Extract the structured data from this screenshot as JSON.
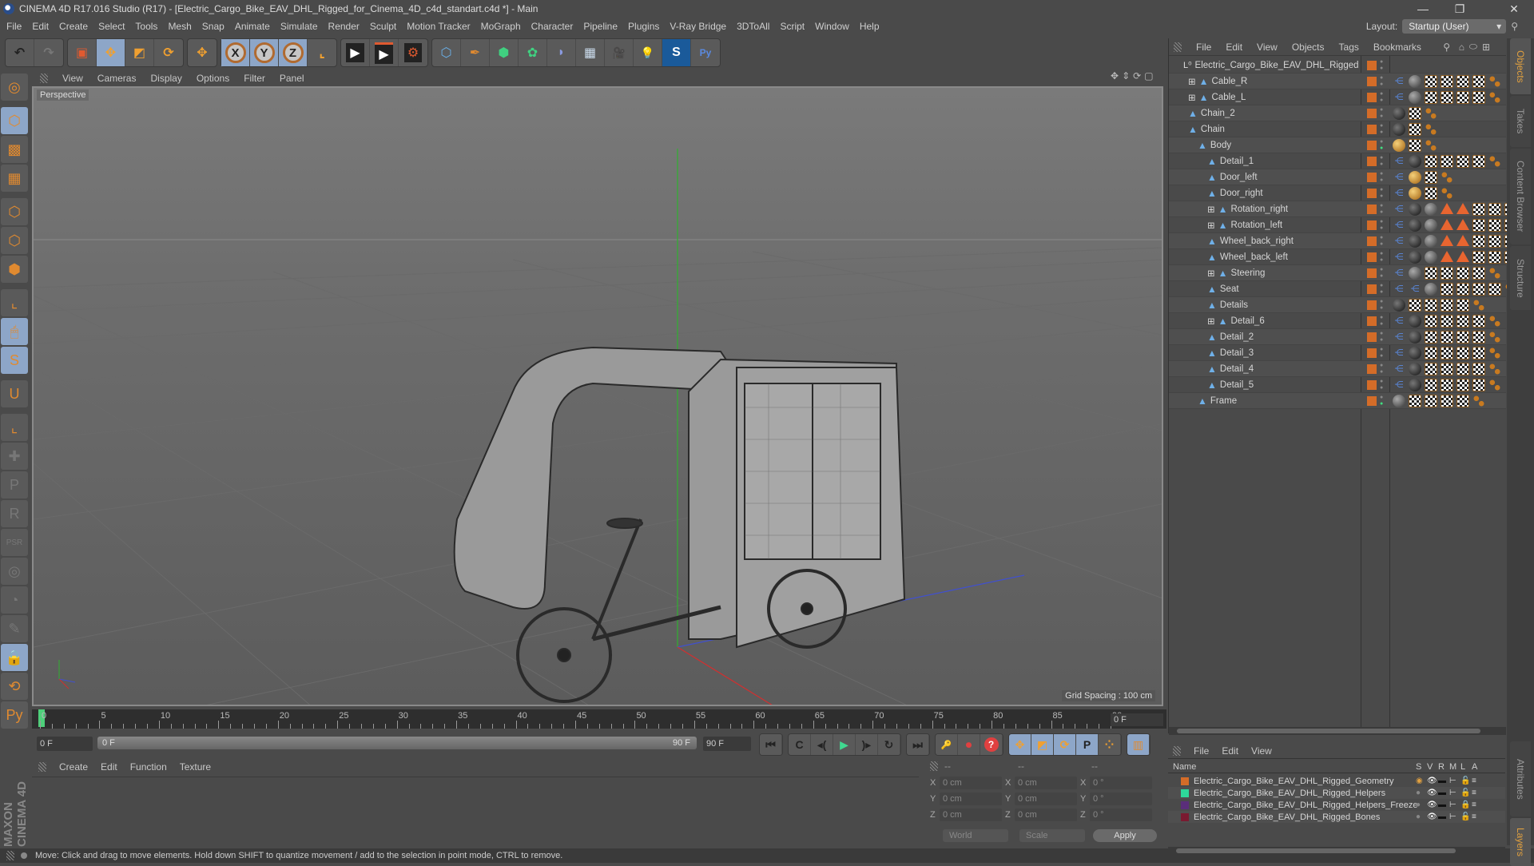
{
  "window": {
    "title": "CINEMA 4D R17.016 Studio (R17) - [Electric_Cargo_Bike_EAV_DHL_Rigged_for_Cinema_4D_c4d_standart.c4d *] - Main",
    "minimize": "—",
    "maximize": "❐",
    "close": "✕"
  },
  "menubar": [
    "File",
    "Edit",
    "Create",
    "Select",
    "Tools",
    "Mesh",
    "Snap",
    "Animate",
    "Simulate",
    "Render",
    "Sculpt",
    "Motion Tracker",
    "MoGraph",
    "Character",
    "Pipeline",
    "Plugins",
    "V-Ray Bridge",
    "3DToAll",
    "Script",
    "Window",
    "Help"
  ],
  "layout": {
    "label": "Layout:",
    "value": "Startup (User)"
  },
  "toolbar": {
    "undo": "↶",
    "redo": "↷",
    "select": "▣",
    "move": "✥",
    "scale": "◩",
    "rotate": "⟳",
    "move2": "✥",
    "x": "X",
    "y": "Y",
    "z": "Z",
    "coord": "⌞",
    "render_view": "▶",
    "render": "▶",
    "render_settings": "⚙",
    "cube": "⬡",
    "pen": "✒",
    "subdiv": "⬢",
    "cloner": "✿",
    "deformer": "◗",
    "floor": "▦",
    "camera": "🎥",
    "light": "💡",
    "sketch": "S",
    "python": "Py"
  },
  "viewport": {
    "menu": [
      "View",
      "Cameras",
      "Display",
      "Options",
      "Filter",
      "Panel"
    ],
    "label": "Perspective",
    "grid_spacing": "Grid Spacing : 100 cm",
    "nav_icons": [
      "✥",
      "⇕",
      "⟳",
      "▢"
    ]
  },
  "left_tools": [
    {
      "name": "make-editable",
      "glyph": "◎",
      "on": false
    },
    {
      "name": "model-mode",
      "glyph": "⬡",
      "on": true
    },
    {
      "name": "texture-mode",
      "glyph": "▩",
      "on": false
    },
    {
      "name": "workplane-mode",
      "glyph": "▦",
      "on": false
    },
    {
      "name": "points-mode",
      "glyph": "⬡",
      "on": false
    },
    {
      "name": "edges-mode",
      "glyph": "⬡",
      "on": false
    },
    {
      "name": "polygons-mode",
      "glyph": "⬢",
      "on": false
    },
    {
      "name": "axis-mode",
      "glyph": "⌞",
      "on": false
    },
    {
      "name": "tweak-mode",
      "glyph": "🖱",
      "on": true
    },
    {
      "name": "snap-settings",
      "glyph": "S",
      "on": true
    },
    {
      "name": "magnet",
      "glyph": "U",
      "on": false
    },
    {
      "name": "workplane-axis",
      "glyph": "⌞",
      "on": false
    },
    {
      "name": "ik-tool",
      "glyph": "✚",
      "on": false,
      "dim": true
    },
    {
      "name": "pin-p",
      "glyph": "P",
      "on": false,
      "dim": true
    },
    {
      "name": "pin-r",
      "glyph": "R",
      "on": false,
      "dim": true
    },
    {
      "name": "pin-psr",
      "glyph": "PSR",
      "on": false,
      "dim": true
    },
    {
      "name": "pin-target",
      "glyph": "◎",
      "on": false,
      "dim": true
    },
    {
      "name": "pin-pie",
      "glyph": "◔",
      "on": false,
      "dim": true
    },
    {
      "name": "pin-edit",
      "glyph": "✎",
      "on": false,
      "dim": true
    },
    {
      "name": "lock-workplane",
      "glyph": "🔒",
      "on": true
    },
    {
      "name": "workplane-rotate",
      "glyph": "⟲",
      "on": false
    },
    {
      "name": "python",
      "glyph": "Py",
      "on": false
    }
  ],
  "brand": "MAXON CINEMA 4D",
  "timeline": {
    "ticks": [
      "0",
      "5",
      "10",
      "15",
      "20",
      "25",
      "30",
      "35",
      "40",
      "45",
      "50",
      "55",
      "60",
      "65",
      "70",
      "75",
      "80",
      "85",
      "90"
    ],
    "current_frame": "0 F",
    "start_field": "0 F",
    "range_start": "0 F",
    "range_end": "90 F",
    "end_field": "90 F",
    "playhead_frame": 0
  },
  "playback": {
    "goto_start": "⏮",
    "prev_key": "C",
    "prev_frame": "◂(",
    "play": "▶",
    "next_frame": ")▸",
    "next_key": "↻",
    "goto_end": "⏭",
    "record_keys": "🔑",
    "autokey": "⏺",
    "key_help": "?",
    "pos": "✥",
    "scale": "◩",
    "rot": "⟳",
    "param": "P",
    "pla": "⁘",
    "timeline_win": "▥"
  },
  "material_manager": {
    "menu": [
      "Create",
      "Edit",
      "Function",
      "Texture"
    ]
  },
  "coordinates": {
    "headers": [
      "--",
      "--",
      "--"
    ],
    "rows": [
      {
        "axis": "X",
        "pos": "0 cm",
        "size": "0 cm",
        "rot": "0 °"
      },
      {
        "axis": "Y",
        "pos": "0 cm",
        "size": "0 cm",
        "rot": "0 °"
      },
      {
        "axis": "Z",
        "pos": "0 cm",
        "size": "0 cm",
        "rot": "0 °"
      }
    ],
    "space": "World",
    "mode": "Scale",
    "apply": "Apply"
  },
  "status": "Move: Click and drag to move elements. Hold down SHIFT to quantize movement / add to the selection in point mode, CTRL to remove.",
  "object_manager": {
    "menu": [
      "File",
      "Edit",
      "View",
      "Objects",
      "Tags",
      "Bookmarks"
    ],
    "root": "Electric_Cargo_Bike_EAV_DHL_Rigged",
    "objects": [
      {
        "name": "Cable_R",
        "depth": 1,
        "expand": true,
        "tags": [
          "ik",
          "matd",
          "chk",
          "chk",
          "chk",
          "chk",
          "dots"
        ]
      },
      {
        "name": "Cable_L",
        "depth": 1,
        "expand": true,
        "tags": [
          "ik",
          "matd",
          "chk",
          "chk",
          "chk",
          "chk",
          "dots"
        ]
      },
      {
        "name": "Chain_2",
        "depth": 1,
        "expand": false,
        "tags": [
          "mat",
          "chk",
          "dots"
        ]
      },
      {
        "name": "Chain",
        "depth": 1,
        "expand": false,
        "tags": [
          "mat",
          "chk",
          "dots"
        ]
      },
      {
        "name": "Body",
        "depth": 2,
        "expand": false,
        "tags": [
          "matg",
          "chk",
          "dots"
        ],
        "green": true
      },
      {
        "name": "Detail_1",
        "depth": 3,
        "expand": false,
        "tags": [
          "ik",
          "mat",
          "chk",
          "chk",
          "chk",
          "chk",
          "dots"
        ]
      },
      {
        "name": "Door_left",
        "depth": 3,
        "expand": false,
        "tags": [
          "ik",
          "matg",
          "chk",
          "dots"
        ]
      },
      {
        "name": "Door_right",
        "depth": 3,
        "expand": false,
        "tags": [
          "ik",
          "matg",
          "chk",
          "dots"
        ]
      },
      {
        "name": "Rotation_right",
        "depth": 3,
        "expand": true,
        "tags": [
          "ik",
          "mat",
          "matd",
          "tri",
          "tri",
          "chk",
          "chk",
          "chk"
        ]
      },
      {
        "name": "Rotation_left",
        "depth": 3,
        "expand": true,
        "tags": [
          "ik",
          "mat",
          "matd",
          "tri",
          "tri",
          "chk",
          "chk",
          "chk"
        ]
      },
      {
        "name": "Wheel_back_right",
        "depth": 3,
        "expand": false,
        "tags": [
          "ik",
          "mat",
          "matd",
          "tri",
          "tri",
          "chk",
          "chk",
          "chk"
        ]
      },
      {
        "name": "Wheel_back_left",
        "depth": 3,
        "expand": false,
        "tags": [
          "ik",
          "mat",
          "matd",
          "tri",
          "tri",
          "chk",
          "chk",
          "chk"
        ]
      },
      {
        "name": "Steering",
        "depth": 3,
        "expand": true,
        "tags": [
          "ik",
          "matd",
          "chk",
          "chk",
          "chk",
          "chk",
          "dots"
        ]
      },
      {
        "name": "Seat",
        "depth": 3,
        "expand": false,
        "tags": [
          "ik",
          "ik",
          "matd",
          "chk",
          "chk",
          "chk",
          "chk",
          "dots"
        ]
      },
      {
        "name": "Details",
        "depth": 3,
        "expand": false,
        "tags": [
          "mat",
          "chk",
          "chk",
          "chk",
          "chk",
          "dots"
        ]
      },
      {
        "name": "Detail_6",
        "depth": 3,
        "expand": true,
        "tags": [
          "ik",
          "mat",
          "chk",
          "chk",
          "chk",
          "chk",
          "dots"
        ]
      },
      {
        "name": "Detail_2",
        "depth": 3,
        "expand": false,
        "tags": [
          "ik",
          "mat",
          "chk",
          "chk",
          "chk",
          "chk",
          "dots"
        ]
      },
      {
        "name": "Detail_3",
        "depth": 3,
        "expand": false,
        "tags": [
          "ik",
          "mat",
          "chk",
          "chk",
          "chk",
          "chk",
          "dots"
        ]
      },
      {
        "name": "Detail_4",
        "depth": 3,
        "expand": false,
        "tags": [
          "ik",
          "mat",
          "chk",
          "chk",
          "chk",
          "chk",
          "dots"
        ]
      },
      {
        "name": "Detail_5",
        "depth": 3,
        "expand": false,
        "tags": [
          "ik",
          "mat",
          "chk",
          "chk",
          "chk",
          "chk",
          "dots"
        ]
      },
      {
        "name": "Frame",
        "depth": 2,
        "expand": false,
        "tags": [
          "matd",
          "chk",
          "chk",
          "chk",
          "chk",
          "dots"
        ],
        "green": true
      }
    ]
  },
  "layer_manager": {
    "menu": [
      "File",
      "Edit",
      "View"
    ],
    "columns": [
      "Name",
      "S",
      "V",
      "R",
      "M",
      "L",
      "A"
    ],
    "layers": [
      {
        "name": "Electric_Cargo_Bike_EAV_DHL_Rigged_Geometry",
        "color": "#d46c28",
        "solo": true,
        "locked": false
      },
      {
        "name": "Electric_Cargo_Bike_EAV_DHL_Rigged_Helpers",
        "color": "#2ed89a",
        "solo": false,
        "locked": false
      },
      {
        "name": "Electric_Cargo_Bike_EAV_DHL_Rigged_Helpers_Freeze",
        "color": "#5a2e7a",
        "solo": false,
        "locked": true
      },
      {
        "name": "Electric_Cargo_Bike_EAV_DHL_Rigged_Bones",
        "color": "#7a1a30",
        "solo": false,
        "locked": false
      }
    ]
  },
  "side_tabs": {
    "top": [
      {
        "label": "Objects",
        "active": true
      },
      {
        "label": "Takes",
        "active": false
      },
      {
        "label": "Content Browser",
        "active": false
      },
      {
        "label": "Structure",
        "active": false
      }
    ],
    "bottom": [
      {
        "label": "Attributes",
        "active": false
      },
      {
        "label": "Layers",
        "active": true
      }
    ]
  },
  "colors": {
    "accent": "#e0a040",
    "selection_blue": "#8da6c8",
    "playhead": "#4ed07a",
    "object_swatch": "#d46c28"
  }
}
